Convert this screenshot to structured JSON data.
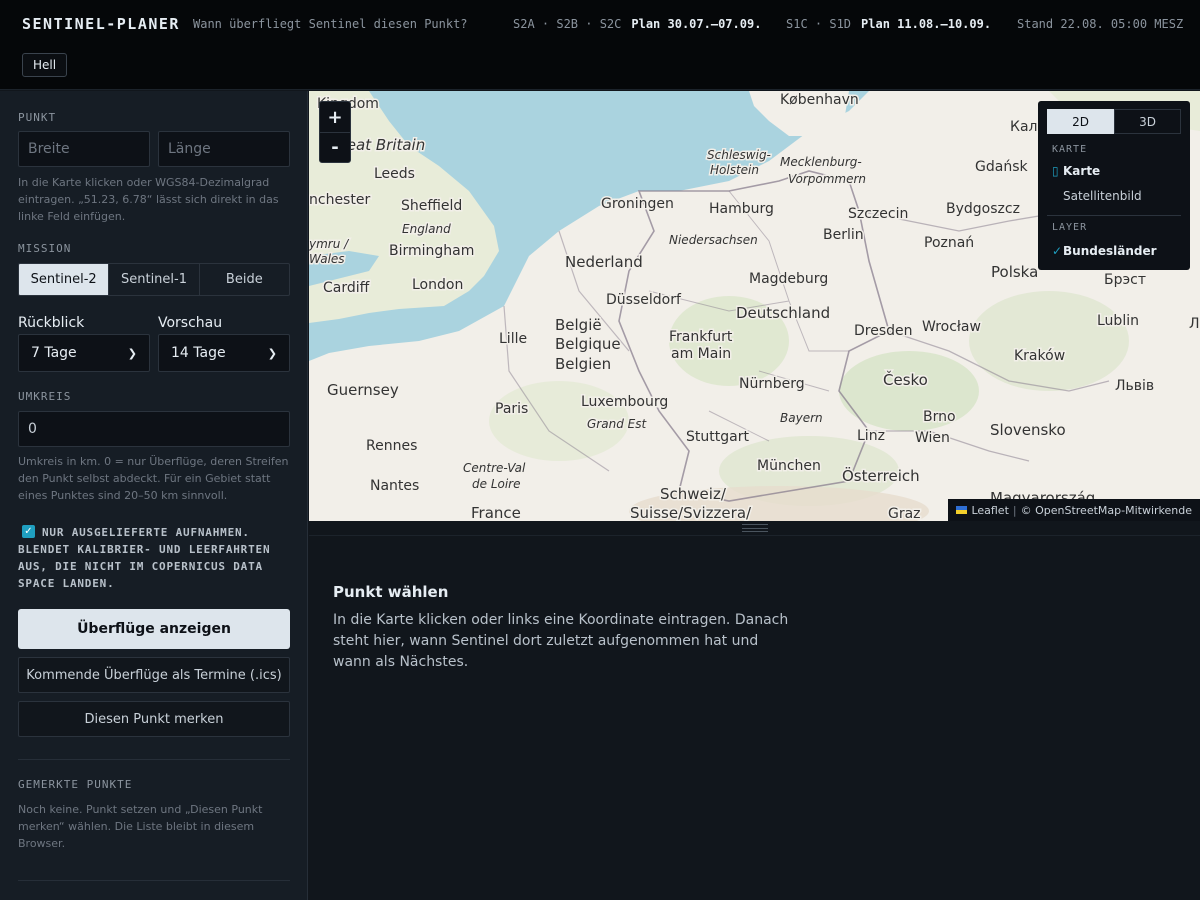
{
  "header": {
    "brand": "SENTINEL-PLANER",
    "tagline": "Wann überfliegt Sentinel diesen Punkt?",
    "group1_sats": "S2A · S2B · S2C",
    "group1_plan": "Plan 30.07.–07.09.",
    "group2_sats": "S1C · S1D",
    "group2_plan": "Plan 11.08.–10.09.",
    "status": "Stand 22.08. 05:00 MESZ",
    "theme_button": "Hell"
  },
  "sidebar": {
    "point_label": "PUNKT",
    "lat_placeholder": "Breite",
    "lon_placeholder": "Länge",
    "point_hint": "In die Karte klicken oder WGS84-Dezimalgrad eintragen. „51.23, 6.78“ lässt sich direkt in das linke Feld einfügen.",
    "mission_label": "MISSION",
    "missions": [
      "Sentinel-2",
      "Sentinel-1",
      "Beide"
    ],
    "lookback_label": "Rückblick",
    "lookback_value": "7 Tage",
    "preview_label": "Vorschau",
    "preview_value": "14 Tage",
    "radius_label": "UMKREIS",
    "radius_value": "0",
    "radius_hint": "Umkreis in km. 0 = nur Überflüge, deren Streifen den Punkt selbst abdeckt. Für ein Gebiet statt eines Punktes sind 20–50 km sinnvoll.",
    "checkbox_text": "NUR AUSGELIEFERTE AUFNAHMEN. BLENDET KALIBRIER- UND LEERFAHRTEN AUS, DIE NICHT IM COPERNICUS DATA SPACE LANDEN.",
    "primary_button": "Überflüge anzeigen",
    "ics_button": "Kommende Überflüge als Termine (.ics)",
    "save_button": "Diesen Punkt merken",
    "saved_label": "GEMERKTE PUNKTE",
    "saved_hint": "Noch keine. Punkt setzen und „Diesen Punkt merken“ wählen. Die Liste bleibt in diesem Browser."
  },
  "map": {
    "zoom_in": "+",
    "zoom_out": "-",
    "tab_2d": "2D",
    "tab_3d": "3D",
    "basemap_label": "KARTE",
    "basemap_options": [
      "Karte",
      "Satellitenbild"
    ],
    "layer_label": "LAYER",
    "layer_options": [
      "Bundesländer"
    ],
    "attribution_leaflet": "Leaflet",
    "attribution_osm": "© OpenStreetMap",
    "attribution_suffix": "-Mitwirkende",
    "places": {
      "kingdom": "Kingdom",
      "kobenhavn": "København",
      "great_britain": "Great Britain",
      "leeds": "Leeds",
      "manchester": "nchester",
      "sheffield": "Sheffield",
      "england": "England",
      "birmingham": "Birmingham",
      "wales1": "ymru /",
      "wales2": "Wales",
      "cardiff": "Cardiff",
      "london": "London",
      "groningen": "Groningen",
      "hamburg": "Hamburg",
      "schleswig": "Schleswig-",
      "holstein": "Holstein",
      "mecklenburg": "Mecklenburg-",
      "vorpommern": "Vorpommern",
      "szczecin": "Szczecin",
      "gdansk": "Gdańsk",
      "bydgoszcz": "Bydgoszcz",
      "kalin": "Кали",
      "niedersachsen": "Niedersachsen",
      "nederland": "Nederland",
      "berlin": "Berlin",
      "poznan": "Poznań",
      "polska": "Polska",
      "brest": "Брэст",
      "magdeburg": "Magdeburg",
      "dusseldorf": "Düsseldorf",
      "belgie": "België",
      "belgique": "Belgique",
      "belgien": "Belgien",
      "lille": "Lille",
      "deutschland": "Deutschland",
      "frankfurt": "Frankfurt",
      "am_main": "am Main",
      "dresden": "Dresden",
      "wroclaw": "Wrocław",
      "lublin": "Lublin",
      "lu": "Лу",
      "krakow": "Kraków",
      "guernsey": "Guernsey",
      "luxembourg": "Luxembourg",
      "nurnberg": "Nürnberg",
      "cesko": "Česko",
      "lviv": "Львів",
      "paris": "Paris",
      "grand_est": "Grand Est",
      "bayern": "Bayern",
      "brno": "Brno",
      "slovensko": "Slovensko",
      "stuttgart": "Stuttgart",
      "linz": "Linz",
      "wien": "Wien",
      "rennes": "Rennes",
      "centre": "Centre-Val",
      "de_loire": "de Loire",
      "munchen": "München",
      "osterreich": "Österreich",
      "nantes": "Nantes",
      "schweiz": "Schweiz/",
      "suisse": "Suisse/Svizzera/",
      "magyar": "Magyarország",
      "france": "France",
      "graz": "Graz"
    }
  },
  "results": {
    "title": "Punkt wählen",
    "text": "In die Karte klicken oder links eine Koordinate eintragen. Danach steht hier, wann Sentinel dort zuletzt aufgenommen hat und wann als Nächstes."
  },
  "colors": {
    "accent": "#1f9fc0",
    "sea": "#aad3df",
    "land": "#f2efe9",
    "primary_button_bg": "#dde5ec"
  }
}
